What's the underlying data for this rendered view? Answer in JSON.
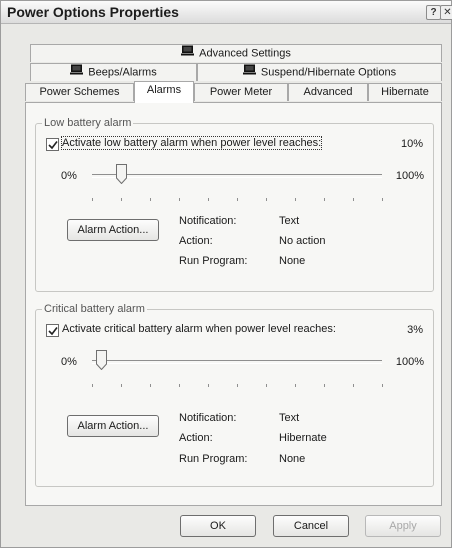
{
  "window": {
    "title": "Power Options Properties",
    "help_glyph": "?",
    "close_glyph": "✕"
  },
  "tabs": {
    "row1": [
      {
        "label": "Advanced Settings",
        "icon": "laptop-icon"
      }
    ],
    "row2": [
      {
        "label": "Beeps/Alarms",
        "icon": "laptop-icon"
      },
      {
        "label": "Suspend/Hibernate Options",
        "icon": "laptop-icon"
      }
    ],
    "row3": [
      {
        "label": "Power Schemes"
      },
      {
        "label": "Alarms",
        "active": true
      },
      {
        "label": "Power Meter"
      },
      {
        "label": "Advanced"
      },
      {
        "label": "Hibernate"
      }
    ]
  },
  "low_battery": {
    "group_title": "Low battery alarm",
    "checkbox_label": "Activate low battery alarm when power level reaches:",
    "checked": true,
    "level_value": "10%",
    "level_fraction": 0.1,
    "slider_min_label": "0%",
    "slider_max_label": "100%",
    "alarm_button_label": "Alarm Action...",
    "notification_label": "Notification:",
    "notification_value": "Text",
    "action_label": "Action:",
    "action_value": "No action",
    "run_program_label": "Run Program:",
    "run_program_value": "None"
  },
  "critical_battery": {
    "group_title": "Critical battery alarm",
    "checkbox_label": "Activate critical battery alarm when power level reaches:",
    "checked": true,
    "level_value": "3%",
    "level_fraction": 0.03,
    "slider_min_label": "0%",
    "slider_max_label": "100%",
    "alarm_button_label": "Alarm Action...",
    "notification_label": "Notification:",
    "notification_value": "Text",
    "action_label": "Action:",
    "action_value": "Hibernate",
    "run_program_label": "Run Program:",
    "run_program_value": "None"
  },
  "footer": {
    "ok_label": "OK",
    "cancel_label": "Cancel",
    "apply_label": "Apply",
    "apply_enabled": false
  }
}
